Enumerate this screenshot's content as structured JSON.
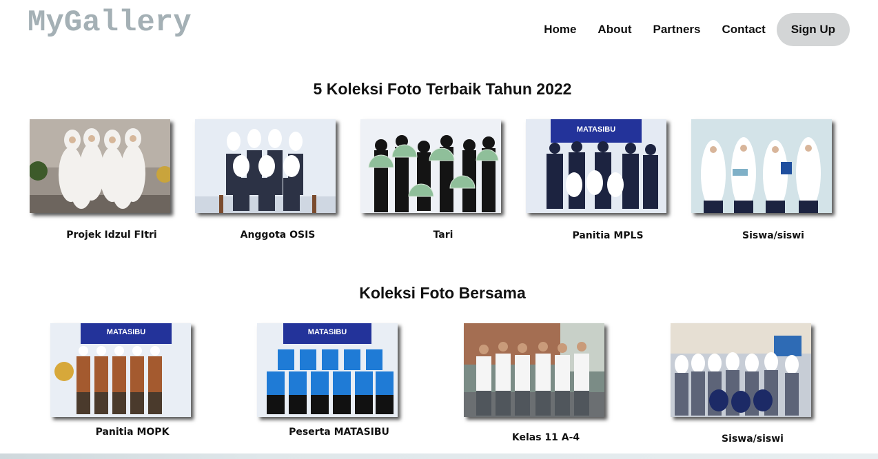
{
  "header": {
    "logo": "MyGallery",
    "nav": [
      "Home",
      "About",
      "Partners",
      "Contact"
    ],
    "signup": "Sign Up"
  },
  "section1": {
    "title": "5 Koleksi Foto Terbaik Tahun 2022",
    "items": [
      {
        "caption": "Projek Idzul FItri"
      },
      {
        "caption": "Anggota OSIS"
      },
      {
        "caption": "Tari"
      },
      {
        "caption": "Panitia MPLS"
      },
      {
        "caption": "Siswa/siswi"
      }
    ]
  },
  "section2": {
    "title": "Koleksi Foto Bersama",
    "items": [
      {
        "caption": "Panitia MOPK"
      },
      {
        "caption": "Peserta MATASIBU"
      },
      {
        "caption": "Kelas 11  A-4"
      },
      {
        "caption": "Siswa/siswi"
      }
    ]
  },
  "banners": {
    "mpls": "MATASIBU",
    "mopk": "MATASIBU",
    "matasibu": "MATASIBU"
  }
}
